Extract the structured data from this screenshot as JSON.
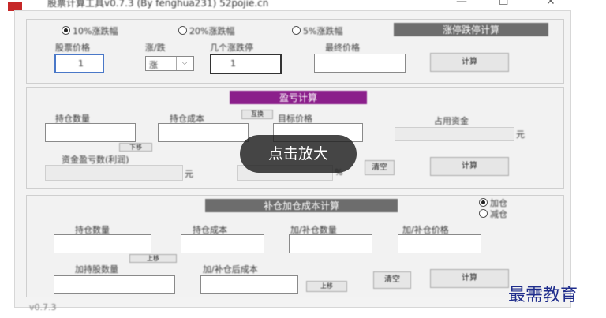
{
  "titlebar": {
    "title": "股票计算工具v0.7.3  (By fenghua231)  52pojie.cn",
    "minimize": "—",
    "maximize": "☐",
    "close": "✕"
  },
  "section1": {
    "radio_10": "10%涨跌幅",
    "radio_20": "20%涨跌幅",
    "radio_5": "5%涨跌幅",
    "banner": "涨停跌停计算",
    "price_label": "股票价格",
    "updown_label": "涨/跌",
    "days_label": "几个涨跌停",
    "final_label": "最终价格",
    "price_value": "1",
    "updown_value": "涨",
    "days_value": "1",
    "final_value": "",
    "calc": "计算"
  },
  "section2": {
    "banner": "盈亏计算",
    "qty_label": "持仓数量",
    "cost_label": "持仓成本",
    "toggle": "互换",
    "target_label": "目标价格",
    "use_label": "占用资金",
    "yuan": "元",
    "move": "下移",
    "pnl_label": "资金盈亏数(利润)",
    "yuan2": "元",
    "percent": "%",
    "clear": "清空",
    "calc": "计算"
  },
  "section3": {
    "banner": "补仓加仓成本计算",
    "radio_add": "加仓",
    "radio_reduce": "减仓",
    "qty_label": "持仓数量",
    "cost_label": "持仓成本",
    "addqty_label": "加/补仓数量",
    "addprice_label": "加/补仓价格",
    "after_qty_label": "加持股数量",
    "after_cost_label": "加/补仓后成本",
    "move1": "上移",
    "move2": "上移",
    "clear": "清空",
    "calc": "计算"
  },
  "statusbar": {
    "text": "v0.7.3"
  },
  "overlay": {
    "text": "点击放大"
  },
  "watermark": {
    "text": "最需教育"
  }
}
